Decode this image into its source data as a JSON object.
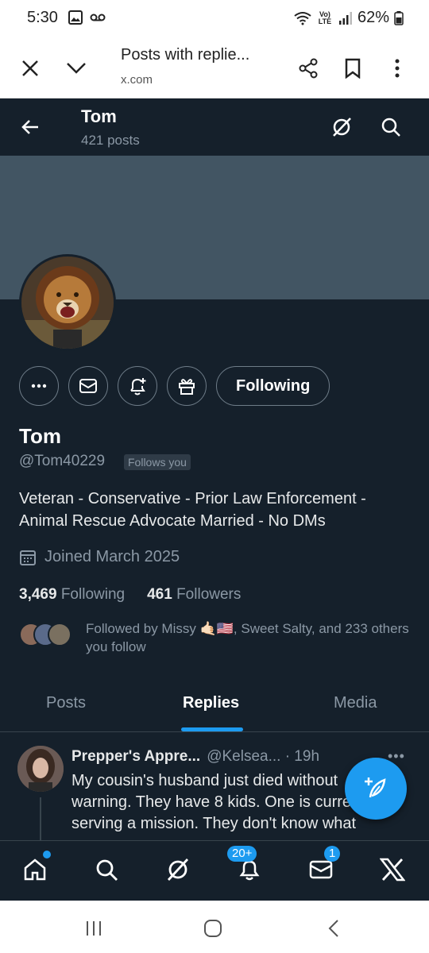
{
  "status_bar": {
    "time": "5:30",
    "battery": "62%",
    "network_label": "Vo) LTE"
  },
  "browser": {
    "title": "Posts with replie...",
    "url": "x.com"
  },
  "profile_header": {
    "name": "Tom",
    "posts_count": "421 posts"
  },
  "profile": {
    "display_name": "Tom",
    "handle": "@Tom40229",
    "follows_you": "Follows you",
    "following_button": "Following",
    "bio": "Veteran - Conservative - Prior Law Enforcement - Animal Rescue Advocate Married - No DMs",
    "joined": "Joined March 2025",
    "following_count": "3,469",
    "following_label": "Following",
    "followers_count": "461",
    "followers_label": "Followers",
    "followed_by": "Followed by Missy 🤙🏻🇺🇸, Sweet Salty, and 233 others you follow"
  },
  "tabs": [
    {
      "label": "Posts"
    },
    {
      "label": "Replies"
    },
    {
      "label": "Media"
    }
  ],
  "active_tab": "Replies",
  "post": {
    "author": "Prepper's Appre...",
    "handle_time": "@Kelsea... · 19h",
    "text": "My cousin's husband just died without warning. They have 8 kids. One is currently serving a mission. They don't know what"
  },
  "bottom_nav": {
    "notifications_badge": "20+",
    "messages_badge": "1"
  },
  "colors": {
    "accent": "#1d9bf0",
    "background": "#15202b",
    "banner": "#425563"
  }
}
